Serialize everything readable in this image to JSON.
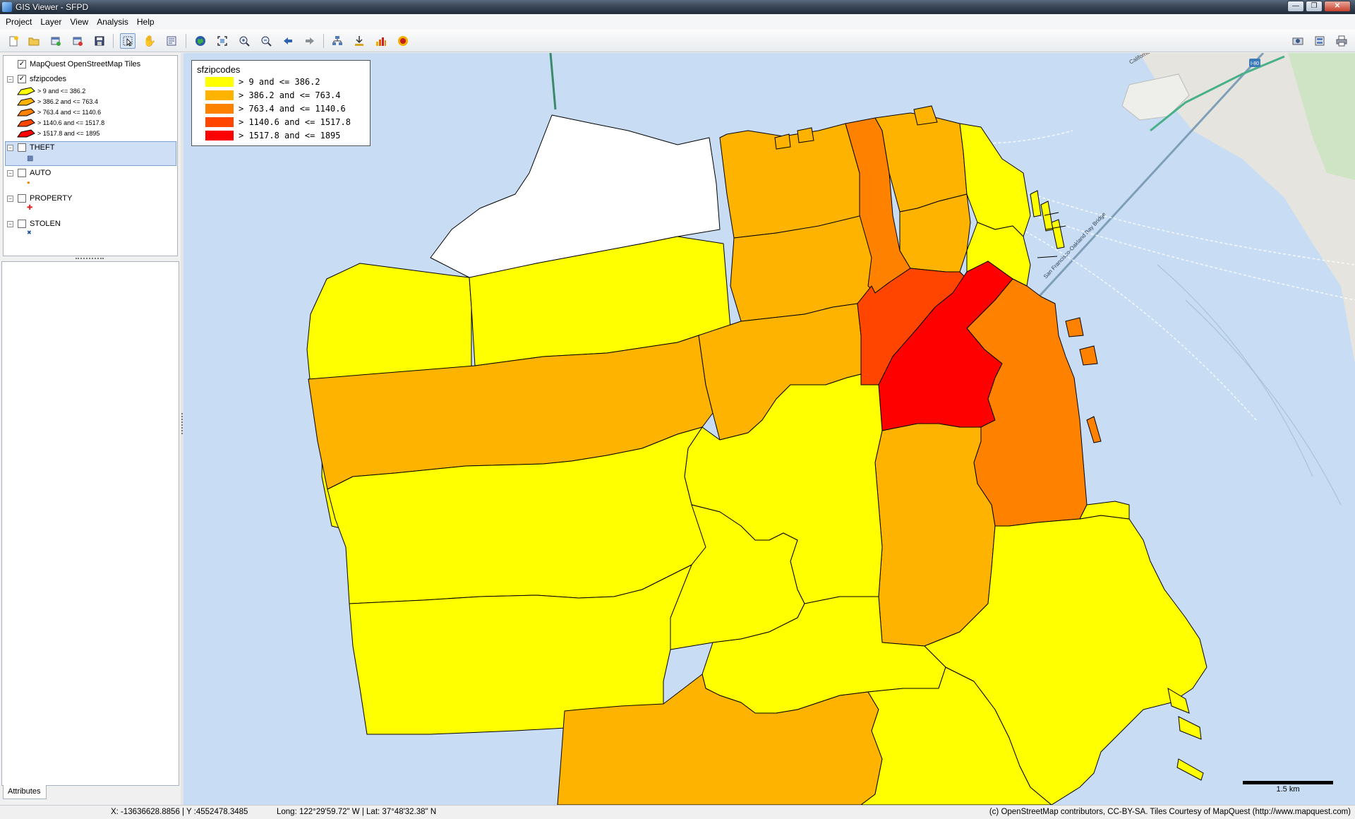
{
  "window": {
    "title": "GIS Viewer - SFPD"
  },
  "menu": [
    "Project",
    "Layer",
    "View",
    "Analysis",
    "Help"
  ],
  "toolbar": {
    "icons": [
      "new-project-icon",
      "open-project-icon",
      "add-layer-icon",
      "remove-layer-icon",
      "save-icon",
      "select-tool-icon",
      "pan-tool-icon",
      "identify-tool-icon",
      "full-extent-icon",
      "zoom-layer-icon",
      "zoom-in-icon",
      "zoom-out-icon",
      "back-icon",
      "forward-icon",
      "layer-properties-icon",
      "attribute-table-icon",
      "chart-icon",
      "record-icon"
    ],
    "right_icons": [
      "print-preview-icon",
      "export-icon",
      "print-icon"
    ]
  },
  "layers": {
    "basemap": {
      "name": "MapQuest OpenStreetMap Tiles",
      "checked": true
    },
    "sfzipcodes": {
      "name": "sfzipcodes",
      "checked": true,
      "classes": [
        "> 9  and  <= 386.2",
        "> 386.2  and  <= 763.4",
        "> 763.4  and  <= 1140.6",
        "> 1140.6  and  <= 1517.8",
        "> 1517.8  and  <= 1895"
      ]
    },
    "point_layers": [
      {
        "name": "THEFT",
        "checked": false,
        "selected": true,
        "symbol": "▩",
        "symbol_color": "#2c4a8a"
      },
      {
        "name": "AUTO",
        "checked": false,
        "selected": false,
        "symbol": "●",
        "symbol_color": "#f08a00"
      },
      {
        "name": "PROPERTY",
        "checked": false,
        "selected": false,
        "symbol": "✚",
        "symbol_color": "#e02020"
      },
      {
        "name": "STOLEN",
        "checked": false,
        "selected": false,
        "symbol": "✖",
        "symbol_color": "#1a4fa0"
      }
    ]
  },
  "attributes_tab": "Attributes",
  "map_legend": {
    "title": "sfzipcodes",
    "rows": [
      {
        "label": "> 9  and  <= 386.2",
        "color": "#ffff00"
      },
      {
        "label": "> 386.2  and  <= 763.4",
        "color": "#feb300"
      },
      {
        "label": "> 763.4  and  <= 1140.6",
        "color": "#fe8200"
      },
      {
        "label": "> 1140.6  and  <= 1517.8",
        "color": "#ff4500"
      },
      {
        "label": "> 1517.8  and  <= 1895",
        "color": "#ff0000"
      }
    ]
  },
  "map": {
    "water_color": "#c8ddf4",
    "street_labels": [
      "California Ave",
      "I-80",
      "San Francisco-Oakland Bay Bridge"
    ],
    "scale_label": "1.5 km"
  },
  "status": {
    "xy": "X: -13636628.8856 | Y :4552478.3485",
    "lonlat": "Long: 122°29'59.72\" W | Lat: 37°48'32.38\" N",
    "attribution": "(c) OpenStreetMap contributors, CC-BY-SA. Tiles Courtesy of MapQuest (http://www.mapquest.com)"
  }
}
